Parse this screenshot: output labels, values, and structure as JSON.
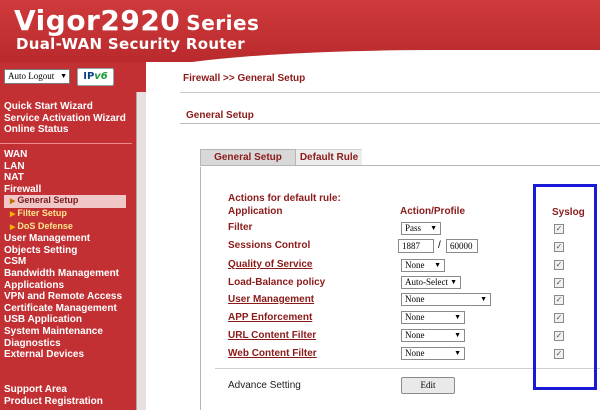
{
  "header": {
    "brand": "Vigor2920",
    "series": "Series",
    "subtitle": "Dual-WAN Security Router"
  },
  "sidebar": {
    "logout_value": "Auto Logout",
    "ipv6_a": "IP",
    "ipv6_b": "v6",
    "group1": [
      "Quick Start Wizard",
      "Service Activation Wizard",
      "Online Status"
    ],
    "group2": [
      "WAN",
      "LAN",
      "NAT",
      "Firewall"
    ],
    "firewall_sub": [
      "General Setup",
      "Filter Setup",
      "DoS Defense"
    ],
    "group3": [
      "User Management",
      "Objects Setting",
      "CSM",
      "Bandwidth Management",
      "Applications",
      "VPN and Remote Access",
      "Certificate Management",
      "USB Application",
      "System Maintenance",
      "Diagnostics",
      "External Devices"
    ],
    "group4": [
      "Support Area",
      "Product Registration"
    ]
  },
  "content": {
    "breadcrumb": "Firewall >> General Setup",
    "section_title": "General Setup",
    "tabs": [
      "General Setup",
      "Default Rule"
    ],
    "actions_heading": "Actions for default rule:",
    "col_application": "Application",
    "col_action": "Action/Profile",
    "col_syslog": "Syslog",
    "rows": [
      {
        "label": "Filter",
        "value": "Pass",
        "syslog": true
      },
      {
        "label": "Sessions Control",
        "value": "1887",
        "max": "60000",
        "syslog": true
      },
      {
        "label": "Quality of Service",
        "value": "None",
        "syslog": true
      },
      {
        "label": "Load-Balance policy",
        "value": "Auto-Select",
        "syslog": true
      },
      {
        "label": "User Management",
        "value": "None",
        "syslog": true
      },
      {
        "label": "APP Enforcement",
        "value": "None",
        "syslog": true
      },
      {
        "label": "URL Content Filter",
        "value": "None",
        "syslog": true
      },
      {
        "label": "Web Content Filter",
        "value": "None",
        "syslog": true
      }
    ],
    "slash": "/",
    "advance_setting": "Advance Setting",
    "edit_label": "Edit"
  },
  "colors": {
    "brand_red": "#c23034",
    "label_red": "#8b1a1a",
    "highlight_blue": "#1a1ad6"
  }
}
